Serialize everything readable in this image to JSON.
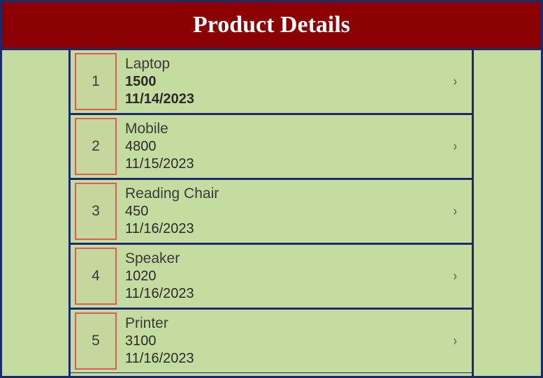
{
  "header": {
    "title": "Product Details"
  },
  "products": [
    {
      "num": "1",
      "name": "Laptop",
      "price": "1500",
      "date": "11/14/2023"
    },
    {
      "num": "2",
      "name": "Mobile",
      "price": "4800",
      "date": "11/15/2023"
    },
    {
      "num": "3",
      "name": "Reading Chair",
      "price": "450",
      "date": "11/16/2023"
    },
    {
      "num": "4",
      "name": "Speaker",
      "price": "1020",
      "date": "11/16/2023"
    },
    {
      "num": "5",
      "name": "Printer",
      "price": "3100",
      "date": "11/16/2023"
    }
  ]
}
